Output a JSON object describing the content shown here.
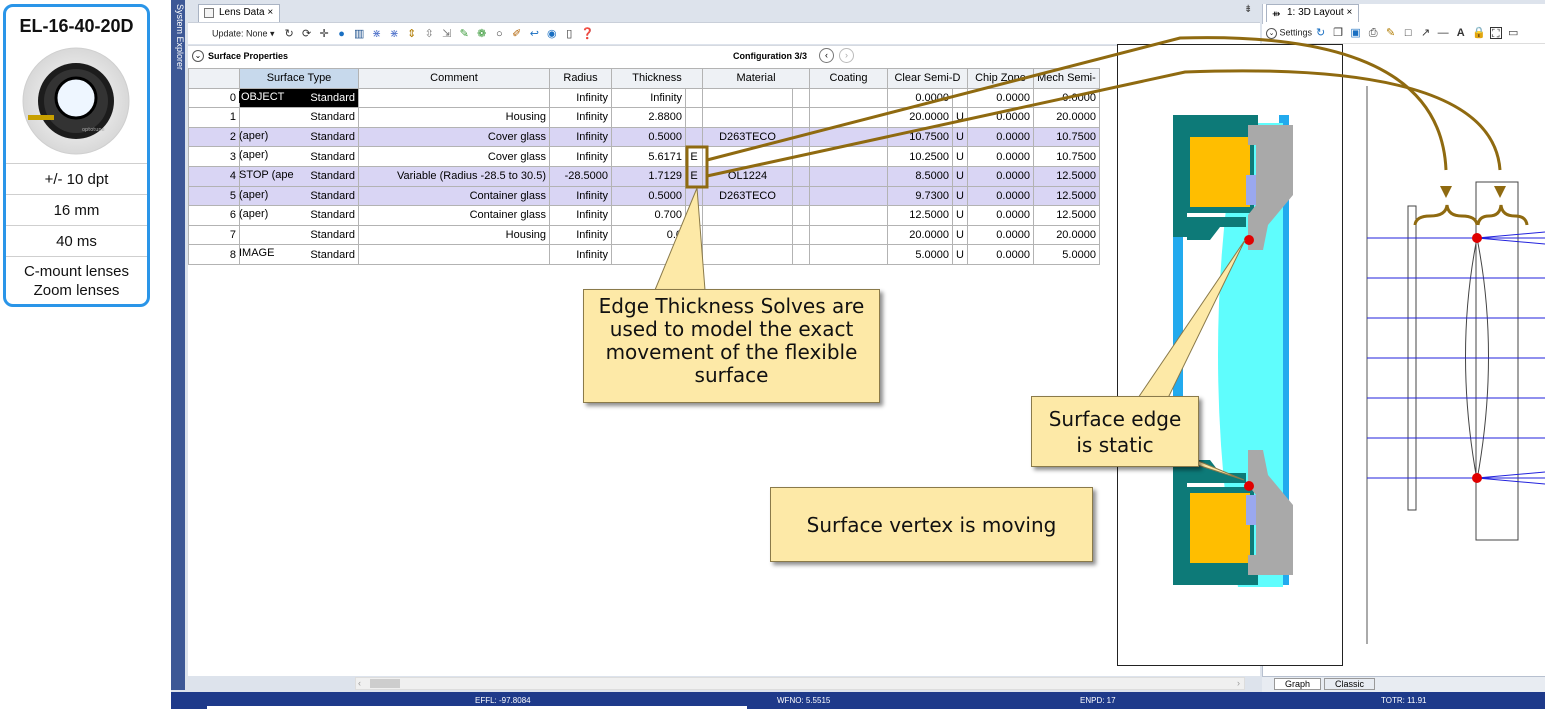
{
  "card": {
    "title": "EL-16-40-20D",
    "specs": [
      "+/- 10 dpt",
      "16 mm",
      "40 ms"
    ],
    "compat_line1": "C-mount lenses",
    "compat_line2": "Zoom lenses"
  },
  "sidebar": {
    "label": "System Explorer"
  },
  "lens_tab": {
    "label": "Lens Data",
    "close": "×"
  },
  "layout_tab": {
    "label": "1: 3D Layout",
    "close": "×"
  },
  "toolbar": {
    "update_label": "Update: None ▾"
  },
  "layout_toolbar": {
    "settings_label": "Settings"
  },
  "surface_properties": {
    "label": "Surface Properties",
    "config_label": "Configuration 3/3"
  },
  "table": {
    "headers": [
      "",
      "Surface Type",
      "Comment",
      "Radius",
      "Thickness",
      "",
      "Material",
      "",
      "Coating",
      "Clear Semi-D",
      "",
      "Chip Zone",
      "Mech Semi-"
    ],
    "rows": [
      [
        "0",
        "OBJECT",
        "Standard",
        "",
        "Infinity",
        "Infinity",
        "",
        "",
        "",
        "",
        "0.0000",
        "",
        "0.0000",
        "0.0000"
      ],
      [
        "1",
        "",
        "Standard",
        "Housing",
        "Infinity",
        "2.8800",
        "",
        "",
        "",
        "",
        "20.0000",
        "U",
        "0.0000",
        "20.0000"
      ],
      [
        "2",
        "(aper)",
        "Standard",
        "Cover glass",
        "Infinity",
        "0.5000",
        "",
        "D263TECO",
        "",
        "",
        "10.7500",
        "U",
        "0.0000",
        "10.7500"
      ],
      [
        "3",
        "(aper)",
        "Standard",
        "Cover glass",
        "Infinity",
        "5.6171",
        "E",
        "",
        "",
        "",
        "10.2500",
        "U",
        "0.0000",
        "10.7500"
      ],
      [
        "4",
        "STOP (ape",
        "Standard",
        "Variable (Radius -28.5 to 30.5)",
        "-28.5000",
        "1.7129",
        "E",
        "OL1224",
        "",
        "",
        "8.5000",
        "U",
        "0.0000",
        "12.5000"
      ],
      [
        "5",
        "(aper)",
        "Standard",
        "Container glass",
        "Infinity",
        "0.5000",
        "",
        "D263TECO",
        "",
        "",
        "9.7300",
        "U",
        "0.0000",
        "12.5000"
      ],
      [
        "6",
        "(aper)",
        "Standard",
        "Container glass",
        "Infinity",
        "0.700",
        "",
        "",
        "",
        "",
        "12.5000",
        "U",
        "0.0000",
        "12.5000"
      ],
      [
        "7",
        "",
        "Standard",
        "Housing",
        "Infinity",
        "0.0",
        "",
        "",
        "",
        "",
        "20.0000",
        "U",
        "0.0000",
        "20.0000"
      ],
      [
        "8",
        "IMAGE",
        "Standard",
        "",
        "Infinity",
        "",
        "",
        "",
        "",
        "",
        "5.0000",
        "U",
        "0.0000",
        "5.0000"
      ]
    ]
  },
  "callouts": {
    "edge_solves": "Edge Thickness Solves are used to model the exact movement of the flexible surface",
    "edge_static_1": "Surface edge",
    "edge_static_2": "is static",
    "vertex_moving": "Surface vertex is moving"
  },
  "bottom_tabs": {
    "graph": "Graph",
    "classic": "Classic"
  },
  "status": {
    "effl": "EFFL: -97.8084",
    "wfno": "WFNO: 5.5515",
    "enpd": "ENPD: 17",
    "totr": "TOTR: 11.91"
  },
  "colors": {
    "accent": "#2a95e8",
    "callout": "#fde9a7",
    "annotation": "#8f6a10",
    "housing": "#0d7a78",
    "coil": "#ffbe00",
    "liquid": "#5ffdfd",
    "statusbar": "#1e3a8a"
  }
}
